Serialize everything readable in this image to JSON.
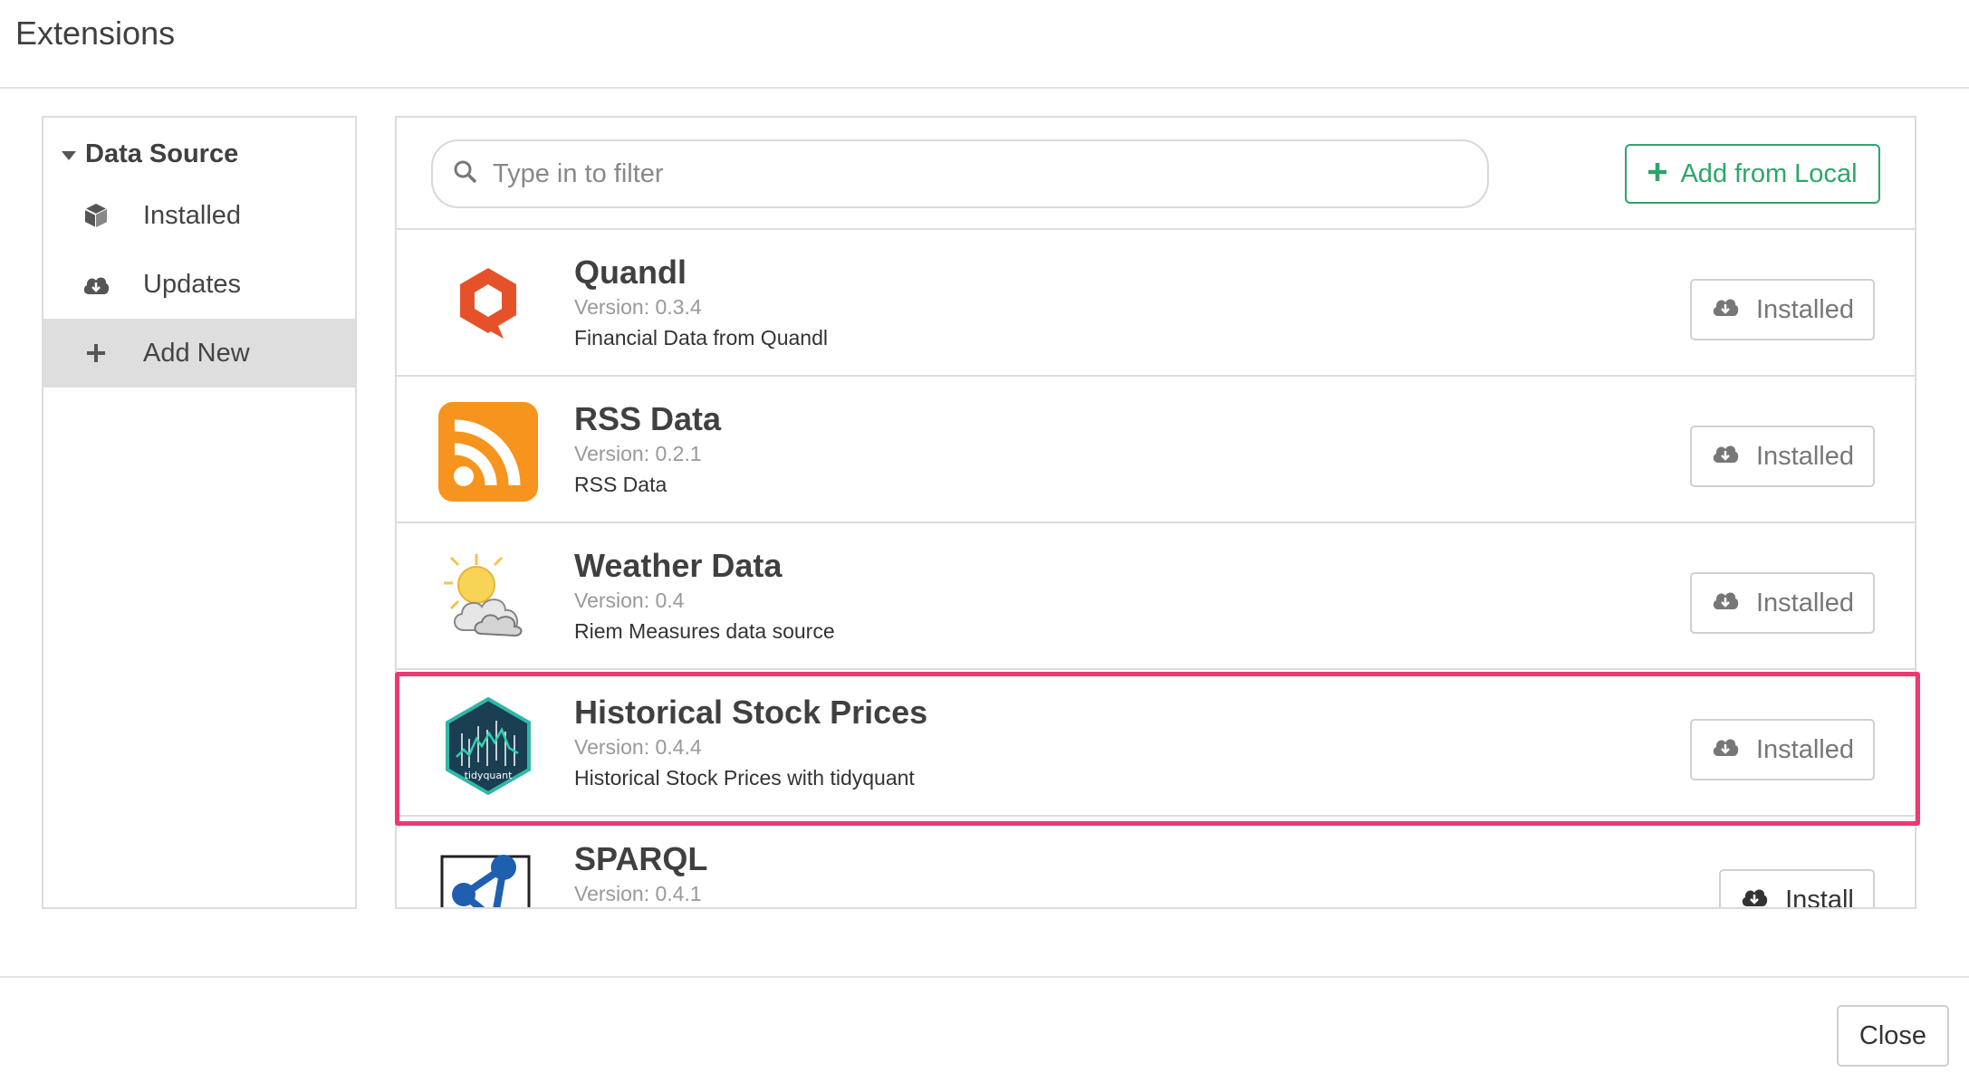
{
  "dialog": {
    "title": "Extensions",
    "close_label": "Close"
  },
  "sidebar": {
    "header": "Data Source",
    "items": [
      {
        "label": "Installed",
        "icon": "cube-icon"
      },
      {
        "label": "Updates",
        "icon": "cloud-download-icon"
      },
      {
        "label": "Add New",
        "icon": "plus-icon",
        "active": true
      }
    ]
  },
  "search": {
    "placeholder": "Type in to filter"
  },
  "toolbar": {
    "add_local_label": "Add from Local",
    "accent": "#2ea56b"
  },
  "extensions": [
    {
      "name": "Quandl",
      "version": "Version: 0.3.4",
      "description": "Financial Data from Quandl",
      "button": "Installed",
      "logo": "quandl-logo"
    },
    {
      "name": "RSS Data",
      "version": "Version: 0.2.1",
      "description": "RSS Data",
      "button": "Installed",
      "logo": "rss-logo"
    },
    {
      "name": "Weather Data",
      "version": "Version: 0.4",
      "description": "Riem Measures data source",
      "button": "Installed",
      "logo": "weather-logo"
    },
    {
      "name": "Historical Stock Prices",
      "version": "Version: 0.4.4",
      "description": "Historical Stock Prices with tidyquant",
      "button": "Installed",
      "logo": "tidyquant-logo",
      "logo_text": "tidyquant",
      "highlighted": true
    },
    {
      "name": "SPARQL",
      "version": "Version: 0.4.1",
      "description": "",
      "button": "Install",
      "logo": "sparql-logo"
    }
  ],
  "colors": {
    "highlight": "#ec3a73",
    "quandl": "#e5522a",
    "rss": "#f7941d"
  }
}
